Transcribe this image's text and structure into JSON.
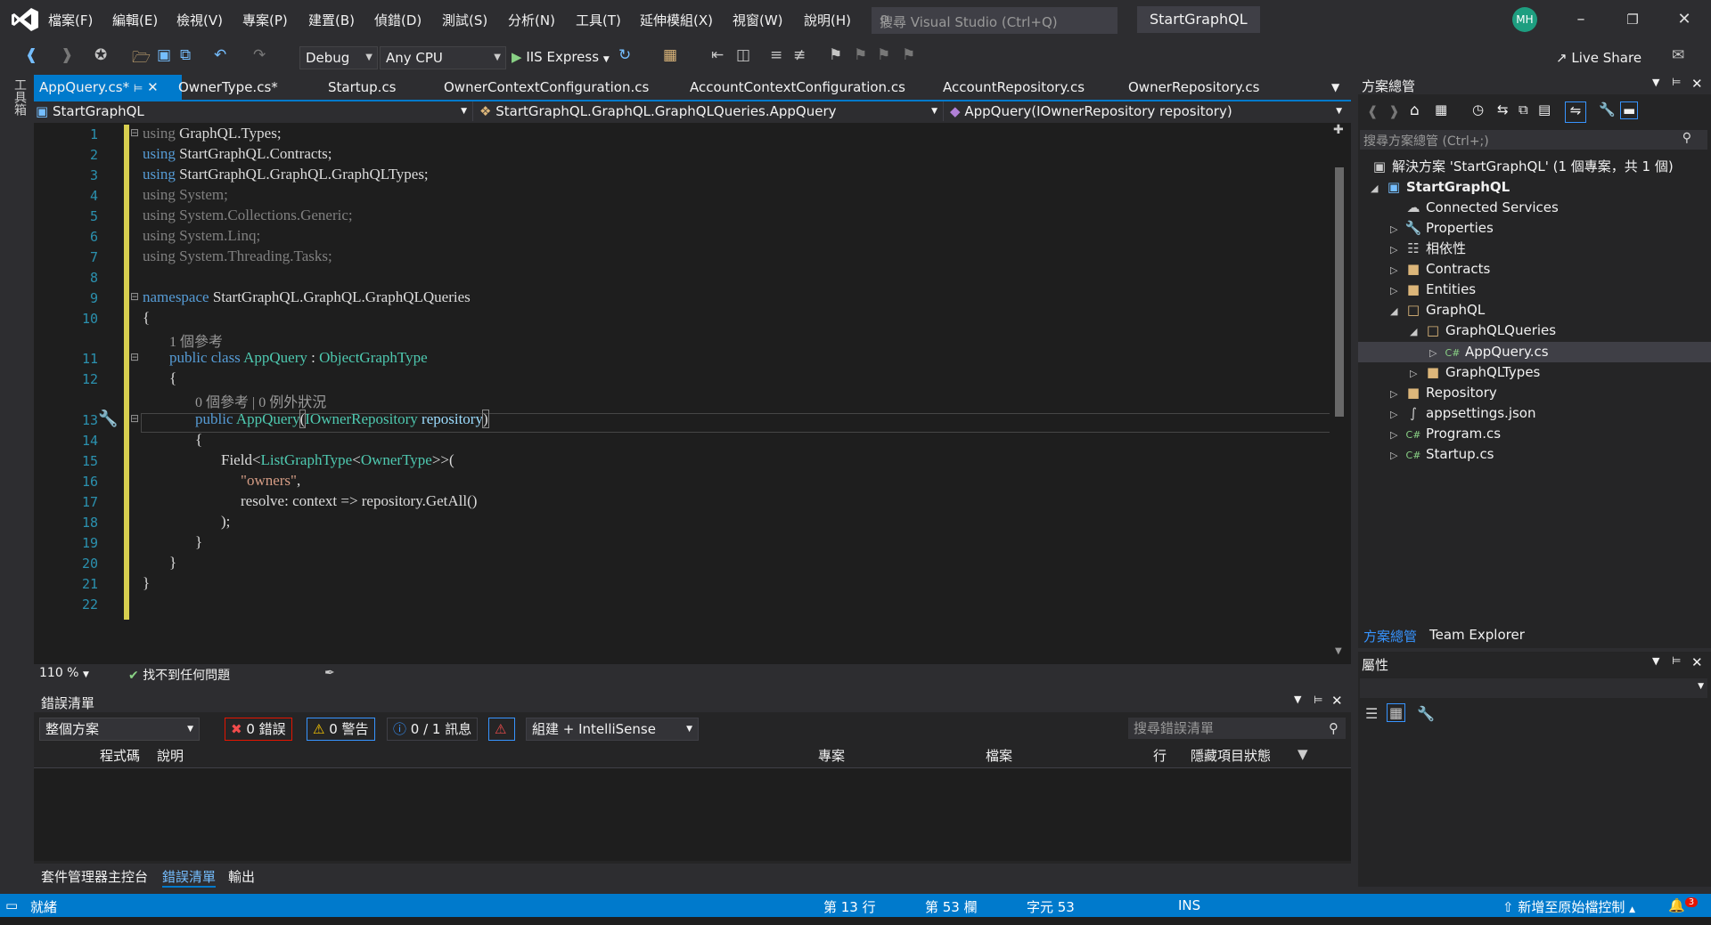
{
  "menu": [
    "檔案(F)",
    "編輯(E)",
    "檢視(V)",
    "專案(P)",
    "建置(B)",
    "偵錯(D)",
    "測試(S)",
    "分析(N)",
    "工具(T)",
    "延伸模組(X)",
    "視窗(W)",
    "說明(H)"
  ],
  "search": {
    "placeholder": "搜尋 Visual Studio (Ctrl+Q)"
  },
  "solution_title": "StartGraphQL",
  "avatar_initials": "MH",
  "toolbar": {
    "config": "Debug",
    "platform": "Any CPU",
    "run": "IIS Express",
    "liveshare": "Live Share"
  },
  "left_strip": "工具箱",
  "tabs": [
    "AppQuery.cs*",
    "OwnerType.cs*",
    "Startup.cs",
    "OwnerContextConfiguration.cs",
    "AccountContextConfiguration.cs",
    "AccountRepository.cs",
    "OwnerRepository.cs"
  ],
  "nav": {
    "project": "StartGraphQL",
    "type": "StartGraphQL.GraphQL.GraphQLQueries.AppQuery",
    "member": "AppQuery(IOwnerRepository repository)"
  },
  "line_numbers": [
    "1",
    "2",
    "3",
    "4",
    "5",
    "6",
    "7",
    "8",
    "9",
    "10",
    "11",
    "12",
    "13",
    "14",
    "15",
    "16",
    "17",
    "18",
    "19",
    "20",
    "21",
    "22"
  ],
  "code": {
    "l1": {
      "k": "using",
      "t": " GraphQL.Types;"
    },
    "l2": {
      "k": "using",
      "t": " StartGraphQL.Contracts;"
    },
    "l3": {
      "k": "using",
      "t": " StartGraphQL.GraphQL.GraphQLTypes;"
    },
    "l4": {
      "k": "using",
      "t": " System;"
    },
    "l5": {
      "k": "using",
      "t": " System.Collections.Generic;"
    },
    "l6": {
      "k": "using",
      "t": " System.Linq;"
    },
    "l7": {
      "k": "using",
      "t": " System.Threading.Tasks;"
    },
    "l9": {
      "k": "namespace",
      "t": " StartGraphQL.GraphQL.GraphQLQueries"
    },
    "l10": "{",
    "hint11": "1 個參考",
    "l11": {
      "k1": "public",
      "k2": "class",
      "name": "AppQuery",
      "sep": " : ",
      "base": "ObjectGraphType"
    },
    "l12": "{",
    "hint13": "0 個參考 | 0 例外狀況",
    "l13": {
      "k": "public",
      "name": "AppQuery",
      "p1": "(",
      "ptype": "IOwnerRepository",
      "pname": " repository",
      "p2": ")"
    },
    "l14": "{",
    "l15": {
      "f": "Field<",
      "t1": "ListGraphType",
      "lt": "<",
      "t2": "OwnerType",
      "e": ">>("
    },
    "l16": {
      "s": "\"owners\"",
      "c": ","
    },
    "l17": "resolve: context => repository.GetAll()",
    "l18": ");",
    "l19": "}",
    "l20": "}",
    "l21": "}"
  },
  "editor_status": {
    "zoom": "110 %",
    "issues": "找不到任何問題"
  },
  "errorlist": {
    "title": "錯誤清單",
    "scope": "整個方案",
    "errors": "0 錯誤",
    "warnings": "0 警告",
    "messages": "0 / 1 訊息",
    "build": "組建 + IntelliSense",
    "search_placeholder": "搜尋錯誤清單",
    "columns": [
      "程式碼",
      "說明",
      "專案",
      "檔案",
      "行",
      "隱藏項目狀態"
    ]
  },
  "bottom_tabs": [
    "套件管理器主控台",
    "錯誤清單",
    "輸出"
  ],
  "solution_explorer": {
    "title": "方案總管",
    "search_placeholder": "搜尋方案總管 (Ctrl+;)",
    "solution": "解決方案 'StartGraphQL' (1 個專案，共 1 個)",
    "project": "StartGraphQL",
    "items": [
      "Connected Services",
      "Properties",
      "相依性",
      "Contracts",
      "Entities",
      "GraphQL",
      "GraphQLQueries",
      "AppQuery.cs",
      "GraphQLTypes",
      "Repository",
      "appsettings.json",
      "Program.cs",
      "Startup.cs"
    ],
    "tabs": [
      "方案總管",
      "Team Explorer"
    ]
  },
  "properties": {
    "title": "屬性"
  },
  "statusbar": {
    "ready": "就緒",
    "line": "第 13 行",
    "col": "第 53 欄",
    "ch": "字元 53",
    "ins": "INS",
    "source": "新增至原始檔控制",
    "notif": "3"
  },
  "colors": {
    "accent": "#007acc",
    "editor_bg": "#1e1e1e",
    "keyword": "#569cd6",
    "type": "#4ec9b0",
    "string": "#d69d85",
    "change_marker": "#d7ce4f"
  }
}
